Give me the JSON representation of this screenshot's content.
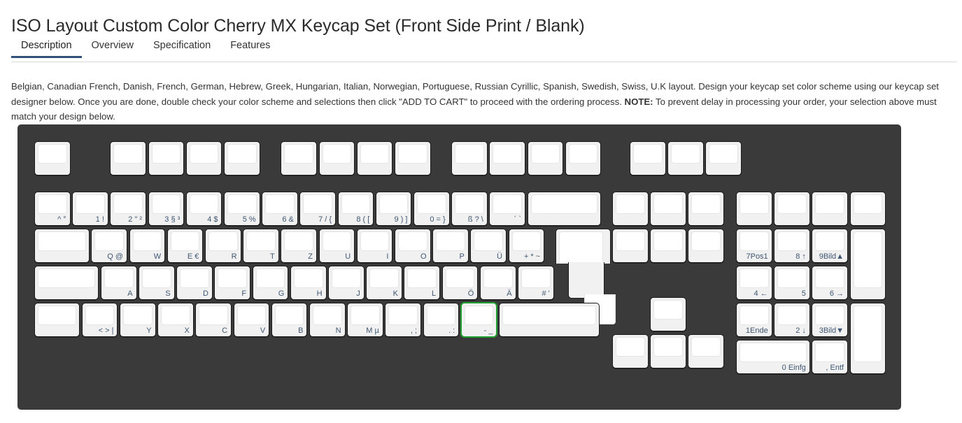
{
  "page": {
    "title": "ISO Layout Custom Color Cherry MX Keycap Set (Front Side Print / Blank)"
  },
  "tabs": [
    {
      "label": "Description",
      "active": true
    },
    {
      "label": "Overview",
      "active": false
    },
    {
      "label": "Specification",
      "active": false
    },
    {
      "label": "Features",
      "active": false
    }
  ],
  "description": {
    "part1": "Belgian, Canadian French, Danish, French, German, Hebrew, Greek, Hungarian, Italian, Norwegian, Portuguese, Russian Cyrillic, Spanish, Swedish, Swiss, U.K layout. Design your keycap set color scheme using our keycap set designer below. Once you are done, double check your color scheme and selections then click \"ADD TO CART\" to proceed with the ordering process. ",
    "note_label": "NOTE:",
    "part2": " To prevent delay in processing your order, your selection above must match your design below."
  },
  "keyboard": {
    "background_color": "#3a3a3a",
    "keycap_color": "#f1f1f1",
    "keycap_top_color": "#ffffff",
    "legend_color": "#3f5672",
    "selected_outline_color": "#1f9d2f",
    "selected_key": "-_",
    "rows": {
      "function": [
        {
          "name": "esc",
          "legend": ""
        },
        {
          "name": "f1",
          "legend": ""
        },
        {
          "name": "f2",
          "legend": ""
        },
        {
          "name": "f3",
          "legend": ""
        },
        {
          "name": "f4",
          "legend": ""
        },
        {
          "name": "f5",
          "legend": ""
        },
        {
          "name": "f6",
          "legend": ""
        },
        {
          "name": "f7",
          "legend": ""
        },
        {
          "name": "f8",
          "legend": ""
        },
        {
          "name": "f9",
          "legend": ""
        },
        {
          "name": "f10",
          "legend": ""
        },
        {
          "name": "f11",
          "legend": ""
        },
        {
          "name": "f12",
          "legend": ""
        },
        {
          "name": "print",
          "legend": ""
        },
        {
          "name": "scroll",
          "legend": ""
        },
        {
          "name": "pause",
          "legend": ""
        }
      ],
      "number": [
        {
          "name": "caret",
          "legend": "^ °"
        },
        {
          "name": "1",
          "legend": "1 !"
        },
        {
          "name": "2",
          "legend": "2 \" ²"
        },
        {
          "name": "3",
          "legend": "3 § ³"
        },
        {
          "name": "4",
          "legend": "4 $"
        },
        {
          "name": "5",
          "legend": "5 %"
        },
        {
          "name": "6",
          "legend": "6 &"
        },
        {
          "name": "7",
          "legend": "7 / {"
        },
        {
          "name": "8",
          "legend": "8 ( ["
        },
        {
          "name": "9",
          "legend": "9 ) ]"
        },
        {
          "name": "0",
          "legend": "0 = }"
        },
        {
          "name": "eszett",
          "legend": "ß ? \\"
        },
        {
          "name": "acute",
          "legend": "´ `"
        },
        {
          "name": "backspace",
          "legend": ""
        }
      ],
      "qwertz": [
        {
          "name": "tab",
          "legend": ""
        },
        {
          "name": "q",
          "legend": "Q @"
        },
        {
          "name": "w",
          "legend": "W"
        },
        {
          "name": "e",
          "legend": "E €"
        },
        {
          "name": "r",
          "legend": "R"
        },
        {
          "name": "t",
          "legend": "T"
        },
        {
          "name": "z",
          "legend": "Z"
        },
        {
          "name": "u",
          "legend": "U"
        },
        {
          "name": "i",
          "legend": "I"
        },
        {
          "name": "o",
          "legend": "O"
        },
        {
          "name": "p",
          "legend": "P"
        },
        {
          "name": "udiaeresis",
          "legend": "Ü"
        },
        {
          "name": "plus",
          "legend": "+ * ~"
        }
      ],
      "home": [
        {
          "name": "capslock",
          "legend": ""
        },
        {
          "name": "a",
          "legend": "A"
        },
        {
          "name": "s",
          "legend": "S"
        },
        {
          "name": "d",
          "legend": "D"
        },
        {
          "name": "f",
          "legend": "F"
        },
        {
          "name": "g",
          "legend": "G"
        },
        {
          "name": "h",
          "legend": "H"
        },
        {
          "name": "j",
          "legend": "J"
        },
        {
          "name": "k",
          "legend": "K"
        },
        {
          "name": "l",
          "legend": "L"
        },
        {
          "name": "odiaeresis",
          "legend": "Ö"
        },
        {
          "name": "adiaeresis",
          "legend": "Ä"
        },
        {
          "name": "hash",
          "legend": "# '"
        }
      ],
      "bottom_letters": [
        {
          "name": "lshift",
          "legend": ""
        },
        {
          "name": "backslash",
          "legend": "< > |"
        },
        {
          "name": "y",
          "legend": "Y"
        },
        {
          "name": "x",
          "legend": "X"
        },
        {
          "name": "c",
          "legend": "C"
        },
        {
          "name": "v",
          "legend": "V"
        },
        {
          "name": "b",
          "legend": "B"
        },
        {
          "name": "n",
          "legend": "N"
        },
        {
          "name": "m",
          "legend": "M µ"
        },
        {
          "name": "comma",
          "legend": ", ;"
        },
        {
          "name": "period",
          "legend": ". :"
        },
        {
          "name": "minus",
          "legend": "- _"
        },
        {
          "name": "rshift",
          "legend": ""
        }
      ],
      "nav_top": [
        {
          "name": "insert",
          "legend": ""
        },
        {
          "name": "home",
          "legend": ""
        },
        {
          "name": "pageup",
          "legend": ""
        },
        {
          "name": "delete",
          "legend": ""
        },
        {
          "name": "end",
          "legend": ""
        },
        {
          "name": "pagedown",
          "legend": ""
        }
      ],
      "arrows": [
        {
          "name": "arrow-up",
          "legend": ""
        },
        {
          "name": "arrow-left",
          "legend": ""
        },
        {
          "name": "arrow-down",
          "legend": ""
        },
        {
          "name": "arrow-right",
          "legend": ""
        }
      ],
      "numpad": [
        {
          "name": "numlock",
          "legend": ""
        },
        {
          "name": "divide",
          "legend": ""
        },
        {
          "name": "multiply",
          "legend": ""
        },
        {
          "name": "subtract",
          "legend": ""
        },
        {
          "name": "np7",
          "legend": "7Pos1"
        },
        {
          "name": "np8",
          "legend": "8 ↑"
        },
        {
          "name": "np9",
          "legend": "9Bild▲"
        },
        {
          "name": "npadd",
          "legend": ""
        },
        {
          "name": "np4",
          "legend": "4 ←"
        },
        {
          "name": "np5",
          "legend": "5"
        },
        {
          "name": "np6",
          "legend": "6 →"
        },
        {
          "name": "np1",
          "legend": "1Ende"
        },
        {
          "name": "np2",
          "legend": "2 ↓"
        },
        {
          "name": "np3",
          "legend": "3Bild▼"
        },
        {
          "name": "npenter",
          "legend": ""
        },
        {
          "name": "np0",
          "legend": "0 Einfg"
        },
        {
          "name": "npdecimal",
          "legend": ", Entf"
        }
      ]
    }
  }
}
